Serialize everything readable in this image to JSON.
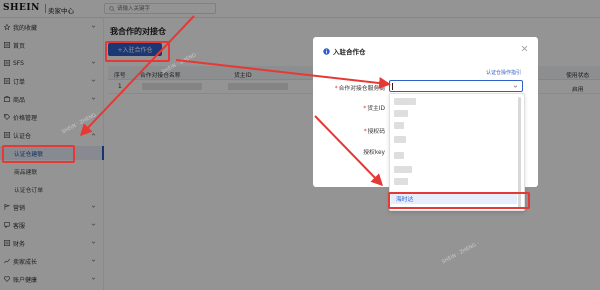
{
  "header": {
    "logo": "SHEIN",
    "subtitle": "卖家中心",
    "search_placeholder": "请输入关键字"
  },
  "sidebar": {
    "items": [
      {
        "label": "我的收藏",
        "icon": "star-icon",
        "chevron": true
      },
      {
        "label": "首页",
        "icon": "list-icon",
        "chevron": false
      },
      {
        "label": "SFS",
        "icon": "list-icon",
        "chevron": true
      },
      {
        "label": "订单",
        "icon": "list-icon",
        "chevron": true
      },
      {
        "label": "商品",
        "icon": "box-icon",
        "chevron": true
      },
      {
        "label": "价格管理",
        "icon": "tag-icon",
        "chevron": false
      },
      {
        "label": "认证仓",
        "icon": "list-icon",
        "chevron": true
      }
    ],
    "subitems": [
      {
        "label": "认证仓建联",
        "active": true
      },
      {
        "label": "商品建联",
        "active": false
      },
      {
        "label": "认证仓订单",
        "active": false
      }
    ],
    "items2": [
      {
        "label": "营销",
        "icon": "flag-icon",
        "chevron": true
      },
      {
        "label": "客服",
        "icon": "chat-icon",
        "chevron": true
      },
      {
        "label": "财务",
        "icon": "list-icon",
        "chevron": true
      },
      {
        "label": "卖家成长",
        "icon": "growth-icon",
        "chevron": true
      },
      {
        "label": "账户健康",
        "icon": "health-icon",
        "chevron": true
      }
    ]
  },
  "main": {
    "title": "我合作的对接仓",
    "add_button": "+入驻合作仓",
    "columns": [
      "序号",
      "合作对接仓名称",
      "货主ID",
      "使用状态"
    ],
    "rows": [
      {
        "index": "1",
        "status": "启用"
      }
    ]
  },
  "modal": {
    "title": "入驻合作仓",
    "help_link": "认证仓操作指引",
    "fields": [
      {
        "label": "合作对接仓服务商",
        "required": true
      },
      {
        "label": "货主ID",
        "required": true
      },
      {
        "label": "授权码",
        "required": true
      },
      {
        "label": "授权key",
        "required": false
      }
    ],
    "highlighted_option": "海时达"
  },
  "colors": {
    "accent": "#2f5fc8",
    "annotation": "#e53935",
    "overlay": "rgba(0,0,0,0.42)"
  }
}
